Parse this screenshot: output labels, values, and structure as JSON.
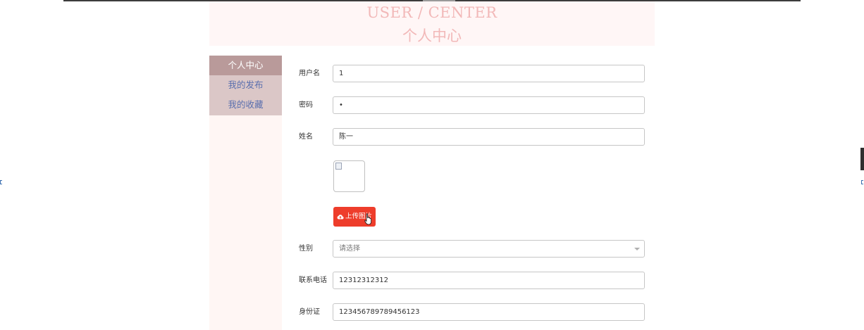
{
  "header": {
    "title_en": "USER / CENTER",
    "title_cn": "个人中心"
  },
  "sidebar": {
    "items": [
      {
        "label": "个人中心",
        "active": true
      },
      {
        "label": "我的发布",
        "active": false
      },
      {
        "label": "我的收藏",
        "active": false
      }
    ]
  },
  "form": {
    "username": {
      "label": "用户名",
      "value": "1"
    },
    "password": {
      "label": "密码",
      "value": "•"
    },
    "name": {
      "label": "姓名",
      "value": "陈一"
    },
    "upload_button": {
      "label": "上传图片",
      "icon": "cloud-upload-icon"
    },
    "gender": {
      "label": "性别",
      "placeholder": "请选择"
    },
    "phone": {
      "label": "联系电话",
      "value": "12312312312"
    },
    "id_card": {
      "label": "身份证",
      "value": "123456789789456123"
    }
  },
  "colors": {
    "header_bg": "#fff6f6",
    "header_text": "#f2b8b8",
    "sidebar_active_bg": "#b99a9a",
    "sidebar_menu_bg": "#dbc7c7",
    "sidebar_link": "#5a6fae",
    "upload_button_bg": "#ee3d2b"
  }
}
